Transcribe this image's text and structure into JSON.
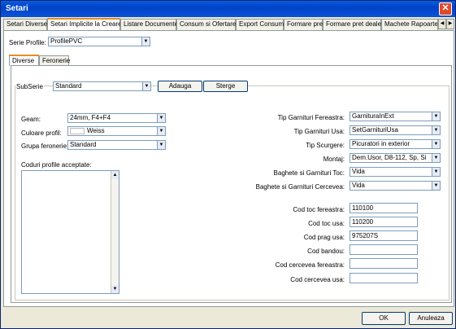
{
  "window": {
    "title": "Setari"
  },
  "tabs": [
    "Setari Diverse",
    "Setari Implicite la Creare",
    "Listare Documente",
    "Consum si Ofertare",
    "Export Consum",
    "Formare pret",
    "Formare pret dealer",
    "Machete Rapoarte"
  ],
  "serie_profile": {
    "label": "Serie Profile:",
    "value": "ProfilePVC"
  },
  "subtabs": [
    "Diverse",
    "Feronerie"
  ],
  "subserie": {
    "label": "SubSerie",
    "value": "Standard",
    "add_label": "Adauga",
    "delete_label": "Sterge"
  },
  "left": {
    "geam_label": "Geam:",
    "geam_value": "24mm, F4+F4",
    "culoare_label": "Culoare profil:",
    "culoare_value": "Weiss",
    "grupa_label": "Grupa feronerie:",
    "grupa_value": "Standard",
    "coduri_label": "Coduri profile acceptate:"
  },
  "right": {
    "tip_fereastra_label": "Tip Garnituri Fereastra:",
    "tip_fereastra_value": "GarnituraInExt",
    "tip_usa_label": "Tip Garnituri Usa:",
    "tip_usa_value": "SetGarnituriUsa",
    "tip_scurgere_label": "Tip Scurgere:",
    "tip_scurgere_value": "Picuratori in exterior",
    "montaj_label": "Montaj:",
    "montaj_value": "Dem.Usor, D8-112, Sp, Si",
    "baghete_toc_label": "Baghete si Garnituri Toc:",
    "baghete_toc_value": "Vida",
    "baghete_cercevea_label": "Baghete si Garnituri Cercevea:",
    "baghete_cercevea_value": "Vida",
    "cod_toc_fereastra_label": "Cod toc fereastra:",
    "cod_toc_fereastra_value": "110100",
    "cod_toc_usa_label": "Cod toc usa:",
    "cod_toc_usa_value": "110200",
    "cod_prag_usa_label": "Cod prag usa:",
    "cod_prag_usa_value": "975207S",
    "cod_bandou_label": "Cod bandou:",
    "cod_bandou_value": "",
    "cod_cercevea_fereastra_label": "Cod cercevea fereastra:",
    "cod_cercevea_fereastra_value": "",
    "cod_cercevea_usa_label": "Cod cercevea usa:",
    "cod_cercevea_usa_value": ""
  },
  "footer": {
    "ok_label": "OK",
    "cancel_label": "Anuleaza"
  }
}
